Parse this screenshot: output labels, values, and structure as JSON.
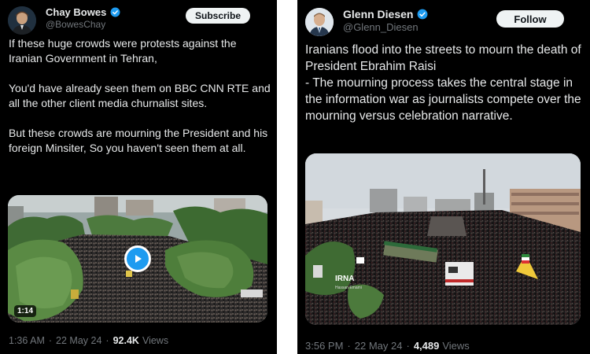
{
  "left_tweet": {
    "display_name": "Chay Bowes",
    "handle": "@BowesChay",
    "button_label": "Subscribe",
    "text": "If these huge crowds were protests against the Iranian Government in Tehran,\n\nYou'd have already seen them on BBC CNN RTE and all the other client media churnalist sites.\n\nBut these crowds are mourning the President and his foreign Minsiter, So you haven't seen them at all.",
    "video_duration": "1:14",
    "time": "1:36 AM",
    "date": "22 May 24",
    "views_count": "92.4K",
    "views_label": "Views",
    "separator": "·",
    "colors": {
      "avatar_bg": "#1b2a3a",
      "verified": "#1d9bf0",
      "play_button": "#1d9bf0"
    },
    "icons": {
      "verified": "verified-badge-icon",
      "play": "play-icon"
    }
  },
  "right_tweet": {
    "display_name": "Glenn Diesen",
    "handle": "@Glenn_Diesen",
    "button_label": "Follow",
    "text": "Iranians flood into the streets to mourn the death of President Ebrahim Raisi\n- The mourning process takes the central stage in the information war as journalists compete over the mourning versus celebration narrative.",
    "image_watermark": "IRNA",
    "image_watermark_sub": "Hassan Emami",
    "time": "3:56 PM",
    "date": "22 May 24",
    "views_count": "4,489",
    "views_label": "Views",
    "separator": "·",
    "colors": {
      "avatar_bg": "#e9eef2",
      "verified": "#1d9bf0"
    },
    "icons": {
      "verified": "verified-badge-icon"
    }
  }
}
